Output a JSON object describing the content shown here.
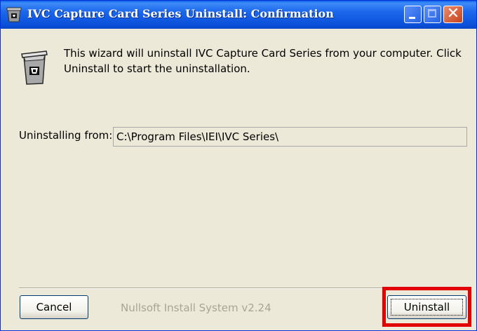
{
  "window": {
    "title": "IVC Capture Card Series Uninstall: Confirmation",
    "minimize_icon": "minimize-icon",
    "maximize_icon": "maximize-icon",
    "close_icon": "close-icon",
    "close_glyph": "✕"
  },
  "content": {
    "intro_text": "This wizard will uninstall IVC Capture Card Series from your computer. Click Uninstall to start the uninstallation.",
    "icon": "recycle-bin-icon",
    "uninstall_from_label": "Uninstalling from:",
    "uninstall_from_value": "C:\\Program Files\\IEI\\IVC Series\\"
  },
  "footer": {
    "cancel_label": "Cancel",
    "branding": "Nullsoft Install System v2.24",
    "uninstall_label": "Uninstall"
  },
  "colors": {
    "titlebar": "#0a4fd9",
    "window_bg": "#ece9d8",
    "highlight": "#e20000",
    "branding_text": "#a8a597"
  }
}
